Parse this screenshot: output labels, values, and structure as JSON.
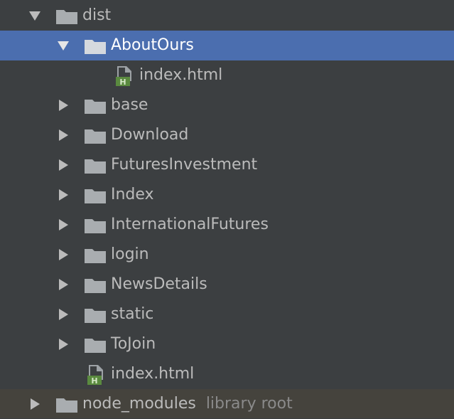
{
  "tree": {
    "dist": {
      "label": "dist"
    },
    "about_ours": {
      "label": "AboutOurs"
    },
    "about_index": {
      "label": "index.html"
    },
    "base": {
      "label": "base"
    },
    "download": {
      "label": "Download"
    },
    "futures_investment": {
      "label": "FuturesInvestment"
    },
    "index": {
      "label": "Index"
    },
    "international_futures": {
      "label": "InternationalFutures"
    },
    "login": {
      "label": "login"
    },
    "news_details": {
      "label": "NewsDetails"
    },
    "static": {
      "label": "static"
    },
    "to_join": {
      "label": "ToJoin"
    },
    "dist_index": {
      "label": "index.html"
    },
    "node_modules": {
      "label": "node_modules",
      "note": "library root"
    }
  },
  "icons": {
    "expanded_arrow": "chevron-down-icon",
    "collapsed_arrow": "chevron-right-icon",
    "folder": "folder-icon",
    "html_file": "html-file-icon"
  },
  "colors": {
    "background": "#3c3f41",
    "selection": "#4b6eaf",
    "library_row": "#45433d",
    "folder": "#a9adb0",
    "html_badge": "#5a8a3f"
  }
}
